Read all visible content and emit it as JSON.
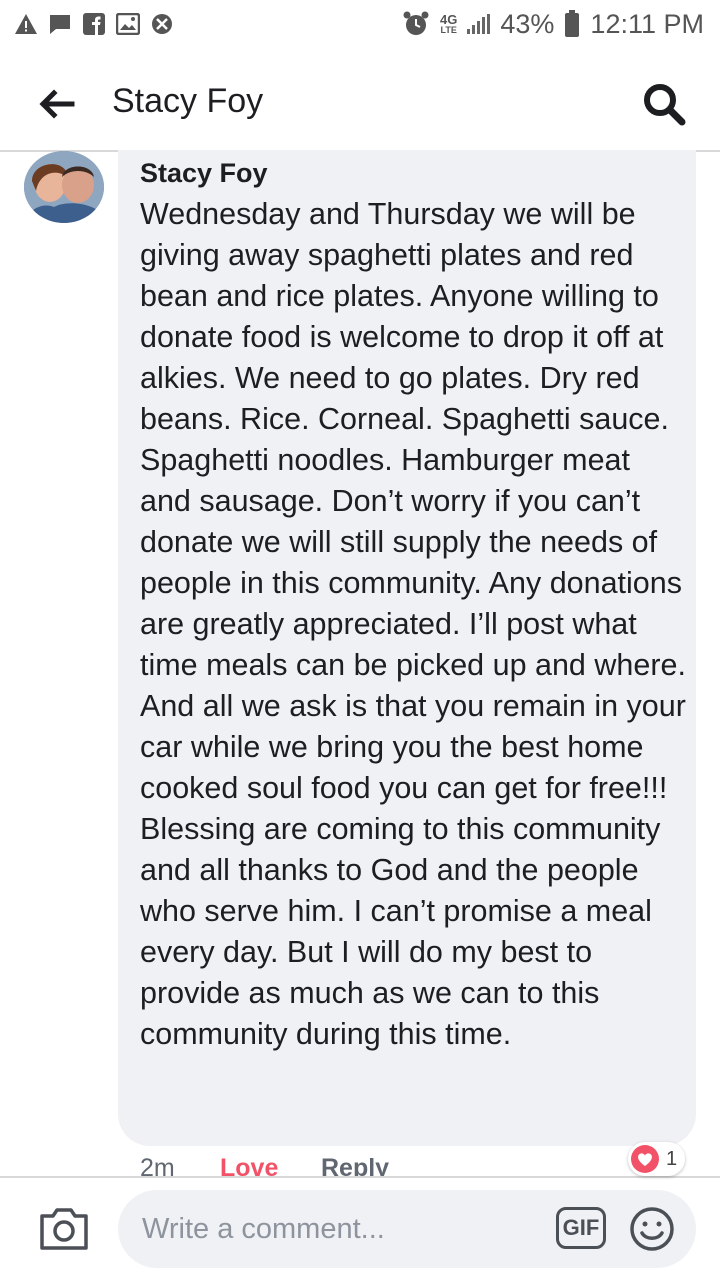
{
  "status_bar": {
    "network": "4G",
    "network_sub": "LTE",
    "battery": "43%",
    "time": "12:11 PM",
    "left_icons": [
      "alert-icon",
      "message-icon",
      "facebook-icon",
      "image-icon",
      "blocked-icon"
    ]
  },
  "header": {
    "title": "Stacy Foy"
  },
  "comment": {
    "author": "Stacy Foy",
    "text": "Wednesday and Thursday we will be giving away spaghetti plates and red bean and rice plates. Anyone willing to donate food is welcome to drop it off at alkies. We need to go plates. Dry red beans. Rice. Corneal. Spaghetti sauce. Spaghetti noodles. Hamburger meat and sausage. Don’t worry if you can’t donate we will still supply the needs of people in this community. Any donations are greatly appreciated. I’ll post what time meals can be picked up and where. And all we ask is that you remain in your car while we bring you the best home cooked soul food you can get for free!!! Blessing are coming to this community and all thanks to God and the people who serve him. I can’t promise a meal every day. But I will do my best to provide as much as we can to this community during this time.",
    "timestamp": "2m",
    "love_label": "Love",
    "reply_label": "Reply",
    "reaction_count": "1"
  },
  "composer": {
    "placeholder": "Write a comment...",
    "gif_label": "GIF"
  },
  "colors": {
    "love": "#f25268",
    "bubble": "#f0f1f5",
    "text": "#1c1e21"
  }
}
